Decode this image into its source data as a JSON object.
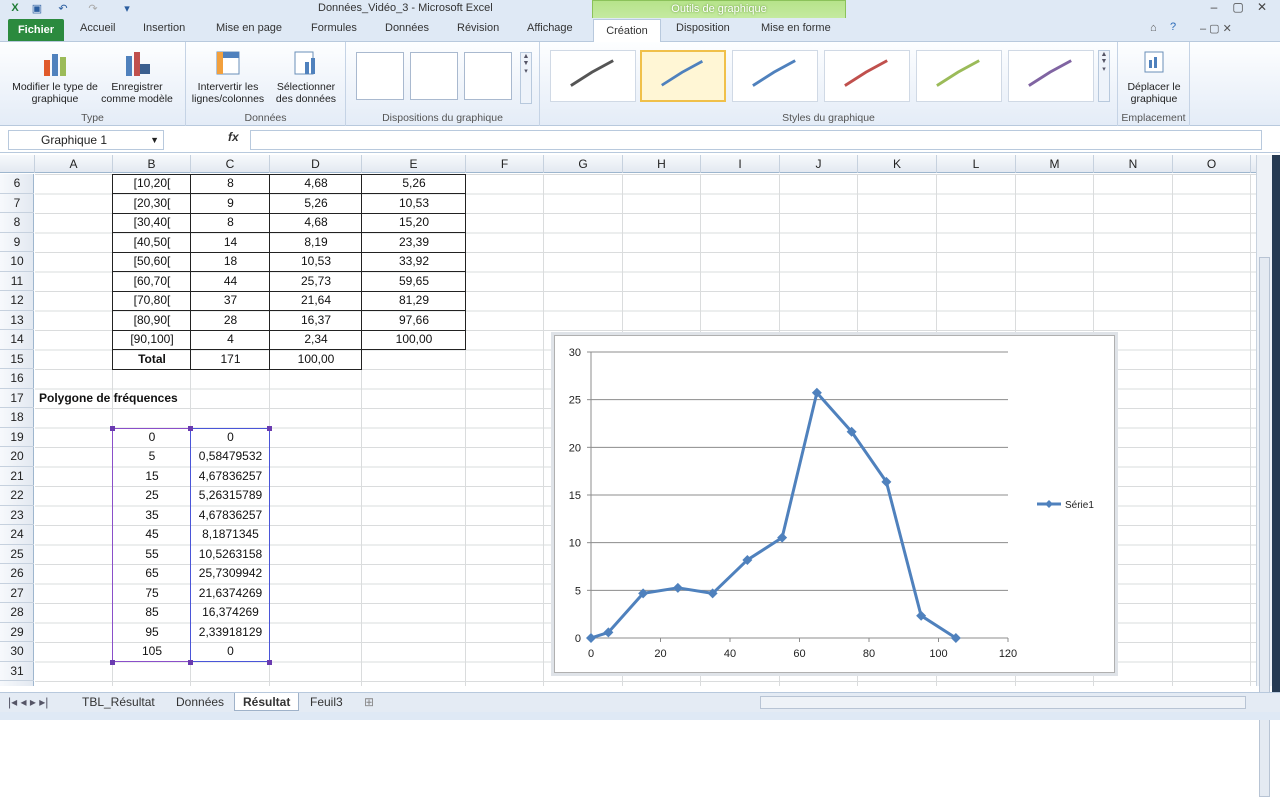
{
  "window": {
    "title": "Données_Vidéo_3  -  Microsoft Excel",
    "context_tab_group": "Outils de graphique"
  },
  "ribbon": {
    "tabs": [
      "Fichier",
      "Accueil",
      "Insertion",
      "Mise en page",
      "Formules",
      "Données",
      "Révision",
      "Affichage",
      "Création",
      "Disposition",
      "Mise en forme"
    ],
    "active_tab": "Création",
    "groups": {
      "type": {
        "label": "Type",
        "btn1": "Modifier le type de graphique",
        "btn2": "Enregistrer comme modèle"
      },
      "donnees": {
        "label": "Données",
        "btn1": "Intervertir les lignes/colonnes",
        "btn2": "Sélectionner des données"
      },
      "dispositions": {
        "label": "Dispositions du graphique"
      },
      "styles": {
        "label": "Styles du graphique",
        "colors": [
          "#555555",
          "#4f81bd",
          "#4f81bd",
          "#c0504d",
          "#9bbb59",
          "#8064a2"
        ]
      },
      "emplacement": {
        "label": "Emplacement",
        "btn1": "Déplacer le graphique"
      }
    }
  },
  "formula_bar": {
    "name_box": "Graphique 1",
    "fx": "fx",
    "value": ""
  },
  "columns": [
    "A",
    "B",
    "C",
    "D",
    "E",
    "F",
    "G",
    "H",
    "I",
    "J",
    "K",
    "L",
    "M",
    "N",
    "O"
  ],
  "rows": [
    "6",
    "7",
    "8",
    "9",
    "10",
    "11",
    "12",
    "13",
    "14",
    "15",
    "16",
    "17",
    "18",
    "19",
    "20",
    "21",
    "22",
    "23",
    "24",
    "25",
    "26",
    "27",
    "28",
    "29",
    "30",
    "31"
  ],
  "table": [
    [
      "[10,20[",
      "8",
      "4,68",
      "5,26"
    ],
    [
      "[20,30[",
      "9",
      "5,26",
      "10,53"
    ],
    [
      "[30,40[",
      "8",
      "4,68",
      "15,20"
    ],
    [
      "[40,50[",
      "14",
      "8,19",
      "23,39"
    ],
    [
      "[50,60[",
      "18",
      "10,53",
      "33,92"
    ],
    [
      "[60,70[",
      "44",
      "25,73",
      "59,65"
    ],
    [
      "[70,80[",
      "37",
      "21,64",
      "81,29"
    ],
    [
      "[80,90[",
      "28",
      "16,37",
      "97,66"
    ],
    [
      "[90,100]",
      "4",
      "2,34",
      "100,00"
    ]
  ],
  "total": {
    "label": "Total",
    "count": "171",
    "pct": "100,00"
  },
  "section_title": "Polygone de fréquences",
  "poly": [
    [
      "0",
      "0"
    ],
    [
      "5",
      "0,58479532"
    ],
    [
      "15",
      "4,67836257"
    ],
    [
      "25",
      "5,26315789"
    ],
    [
      "35",
      "4,67836257"
    ],
    [
      "45",
      "8,1871345"
    ],
    [
      "55",
      "10,5263158"
    ],
    [
      "65",
      "25,7309942"
    ],
    [
      "75",
      "21,6374269"
    ],
    [
      "85",
      "16,374269"
    ],
    [
      "95",
      "2,33918129"
    ],
    [
      "105",
      "0"
    ]
  ],
  "chart_data": {
    "type": "line",
    "x": [
      0,
      5,
      15,
      25,
      35,
      45,
      55,
      65,
      75,
      85,
      95,
      105
    ],
    "series": [
      {
        "name": "Série1",
        "values": [
          0,
          0.58479532,
          4.67836257,
          5.26315789,
          4.67836257,
          8.1871345,
          10.5263158,
          25.7309942,
          21.6374269,
          16.374269,
          2.33918129,
          0
        ]
      }
    ],
    "xlim": [
      0,
      120
    ],
    "ylim": [
      0,
      30
    ],
    "xticks": [
      "0",
      "20",
      "40",
      "60",
      "80",
      "100",
      "120"
    ],
    "yticks": [
      "0",
      "5",
      "10",
      "15",
      "20",
      "25",
      "30"
    ],
    "legend": "right",
    "color": "#4f81bd",
    "grid": true
  },
  "sheet_tabs": [
    "TBL_Résultat",
    "Données",
    "Résultat",
    "Feuil3"
  ],
  "active_sheet": "Résultat"
}
